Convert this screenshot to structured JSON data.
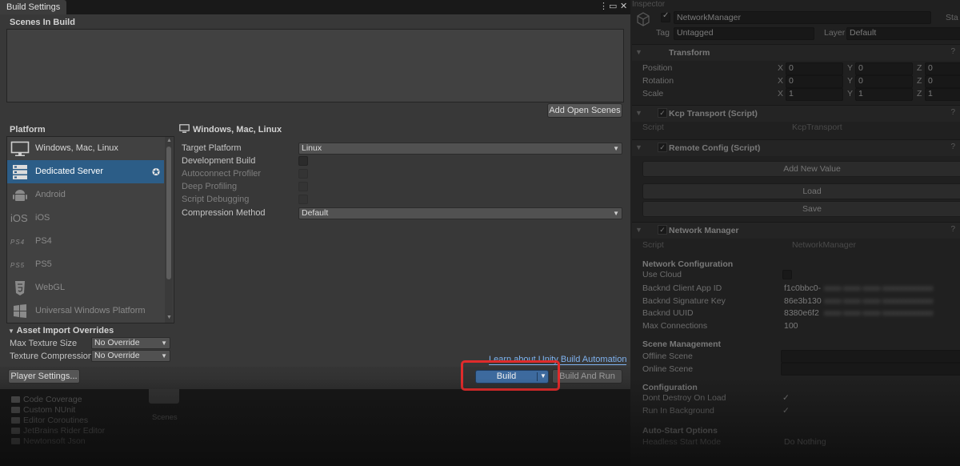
{
  "window": {
    "tab_label": "Build Settings",
    "scenes_in_build": "Scenes In Build",
    "add_open_scenes": "Add Open Scenes",
    "platform_label": "Platform",
    "platforms": [
      {
        "label": "Windows, Mac, Linux",
        "icon": "monitor-icon"
      },
      {
        "label": "Dedicated Server",
        "icon": "server-icon",
        "selected": true
      },
      {
        "label": "Android",
        "icon": "android-icon"
      },
      {
        "label": "iOS",
        "icon": "ios-icon"
      },
      {
        "label": "PS4",
        "icon": "ps4-icon"
      },
      {
        "label": "PS5",
        "icon": "ps5-icon"
      },
      {
        "label": "WebGL",
        "icon": "html5-icon"
      },
      {
        "label": "Universal Windows Platform",
        "icon": "windows-icon"
      }
    ],
    "platform_ios_glyph": "iOS",
    "platform_ps4_glyph": "PS4",
    "platform_ps5_glyph": "PS5",
    "settings_header": "Windows, Mac, Linux",
    "target_platform_label": "Target Platform",
    "target_platform_value": "Linux",
    "development_build": "Development Build",
    "autoconnect_profiler": "Autoconnect Profiler",
    "deep_profiling": "Deep Profiling",
    "script_debugging": "Script Debugging",
    "compression_method_label": "Compression Method",
    "compression_method_value": "Default",
    "asset_import_overrides": "Asset Import Overrides",
    "max_texture_size_label": "Max Texture Size",
    "max_texture_size_value": "No Override",
    "texture_compression_label": "Texture Compression",
    "texture_compression_value": "No Override",
    "learn_link": "Learn about Unity Build Automation",
    "player_settings": "Player Settings...",
    "build": "Build",
    "build_and_run": "Build And Run"
  },
  "inspector": {
    "tab": "Inspector",
    "object_name": "NetworkManager",
    "static_label": "Sta",
    "tag_label": "Tag",
    "tag_value": "Untagged",
    "layer_label": "Layer",
    "layer_value": "Default",
    "transform": "Transform",
    "position": "Position",
    "rotation": "Rotation",
    "scale": "Scale",
    "axis_x": "X",
    "axis_y": "Y",
    "axis_z": "Z",
    "pos": [
      "0",
      "0",
      "0"
    ],
    "rot": [
      "0",
      "0",
      "0"
    ],
    "scl": [
      "1",
      "1",
      "1"
    ],
    "kcp_transport": "Kcp Transport (Script)",
    "script_label": "Script",
    "kcp_script": "KcpTransport",
    "remote_config": "Remote Config (Script)",
    "add_new_value": "Add New Value",
    "load": "Load",
    "save": "Save",
    "network_manager": "Network Manager",
    "nm_script": "NetworkManager",
    "network_configuration": "Network Configuration",
    "use_cloud": "Use Cloud",
    "client_app_id_label": "Backnd Client App ID",
    "client_app_id_value": "f1c0bbc0-",
    "signature_key_label": "Backnd Signature Key",
    "signature_key_value": "86e3b130",
    "uuid_label": "Backnd UUID",
    "uuid_value": "8380e6f2",
    "max_connections_label": "Max Connections",
    "max_connections_value": "100",
    "scene_management": "Scene Management",
    "offline_scene": "Offline Scene",
    "online_scene": "Online Scene",
    "configuration": "Configuration",
    "dont_destroy": "Dont Destroy On Load",
    "run_in_background": "Run In Background",
    "auto_start_options": "Auto-Start Options",
    "headless_start_mode": "Headless Start Mode",
    "headless_value": "Do Nothing"
  },
  "project": {
    "items": [
      "Code Coverage",
      "Custom NUnit",
      "Editor Coroutines",
      "JetBrains Rider Editor",
      "Newtonsoft Json"
    ],
    "scenes_label": "Scenes"
  }
}
